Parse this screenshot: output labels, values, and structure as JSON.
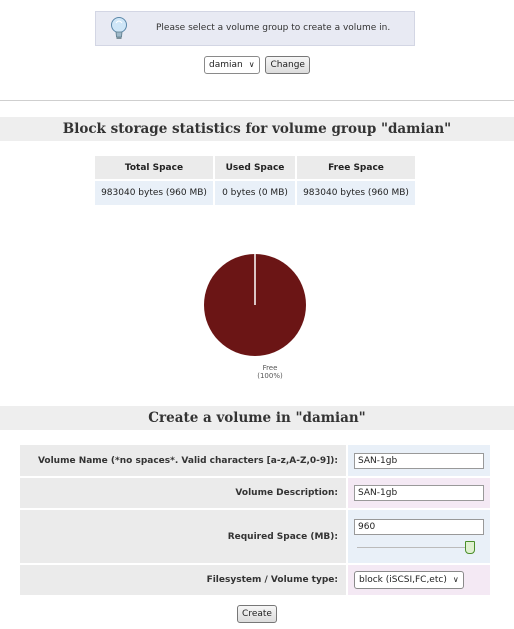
{
  "info": {
    "message": "Please select a volume group to create a volume in.",
    "icon": "lightbulb-icon"
  },
  "vg_select": {
    "selected": "damian",
    "change_label": "Change"
  },
  "stats": {
    "title": "Block storage statistics for volume group \"damian\"",
    "headers": [
      "Total Space",
      "Used Space",
      "Free Space"
    ],
    "values": [
      "983040 bytes (960 MB)",
      "0 bytes (0 MB)",
      "983040 bytes (960 MB)"
    ]
  },
  "chart_data": {
    "type": "pie",
    "slices": [
      {
        "label": "Free",
        "value": 100,
        "color": "#6b1515"
      }
    ],
    "labels": {
      "free": "Free",
      "percent": "(100%)"
    }
  },
  "create": {
    "title": "Create a volume in \"damian\"",
    "name_label": "Volume Name (*no spaces*. Valid characters [a-z,A-Z,0-9]):",
    "name_value": "SAN-1gb",
    "desc_label": "Volume Description:",
    "desc_value": "SAN-1gb",
    "space_label": "Required Space (MB):",
    "space_value": "960",
    "space_slider_fraction": 1.0,
    "fs_label": "Filesystem / Volume type:",
    "fs_selected": "block (iSCSI,FC,etc)",
    "submit_label": "Create"
  }
}
